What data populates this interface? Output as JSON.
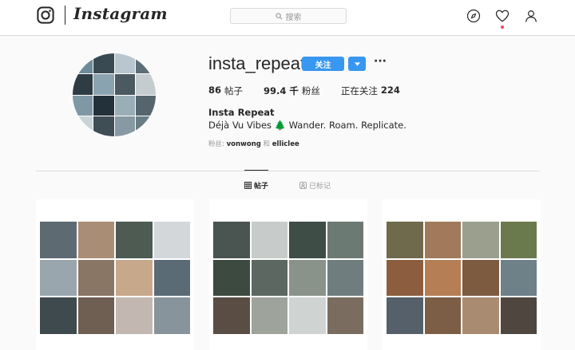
{
  "header": {
    "brand": "Instagram",
    "search_placeholder": "搜索"
  },
  "profile": {
    "username": "insta_repeat",
    "follow_label": "关注",
    "more_label": "···",
    "stats": [
      {
        "value": "86",
        "label": "帖子"
      },
      {
        "value": "99.4 千",
        "label": "粉丝"
      },
      {
        "value": "224",
        "label": "正在关注",
        "prefix": true
      }
    ],
    "full_name": "Insta Repeat",
    "bio": "Déjà Vu Vibes 🌲 Wander. Roam. Replicate.",
    "followed_by_label": "粉丝:",
    "followed_by_user1": "vonwong",
    "followed_by_and": "和",
    "followed_by_user2": "elliclee"
  },
  "tabs": [
    {
      "label": "帖子",
      "active": true
    },
    {
      "label": "已标记",
      "active": false
    }
  ],
  "colors": {
    "accent": "#3897f0",
    "notification": "#ed4956"
  },
  "avatar_tiles": [
    "#6d8a9a",
    "#3a4a52",
    "#b9c6cf",
    "#5d6e78",
    "#2e3c44",
    "#8aa3b0",
    "#4b5960",
    "#c4ccd0",
    "#7f98a6",
    "#23313a",
    "#9aaeb8",
    "#56656d",
    "#c9d3d8",
    "#3f4d55",
    "#8799a3",
    "#6a7d86"
  ],
  "posts": [
    {
      "tiles": [
        "#5d6a72",
        "#a98d74",
        "#4d5b52",
        "#d3d7da",
        "#9aa6ae",
        "#8a7665",
        "#c8a88b",
        "#5a6b76",
        "#3e4a4e",
        "#6f5e52",
        "#c3b7b1",
        "#88949c"
      ]
    },
    {
      "tiles": [
        "#4a5450",
        "#c7cbc9",
        "#3e4d45",
        "#6b7a72",
        "#3c4a3f",
        "#5d6761",
        "#8a9389",
        "#6f7d7f",
        "#5a4d44",
        "#9ea39c",
        "#cfd3d2",
        "#7a6d5f"
      ]
    },
    {
      "tiles": [
        "#6f6a4b",
        "#a07a5a",
        "#9aa08d",
        "#6b7a4c",
        "#8c5e3f",
        "#b57e55",
        "#7d5b41",
        "#6e8088",
        "#55606a",
        "#7b5e45",
        "#a98b72",
        "#4f4640"
      ]
    }
  ]
}
